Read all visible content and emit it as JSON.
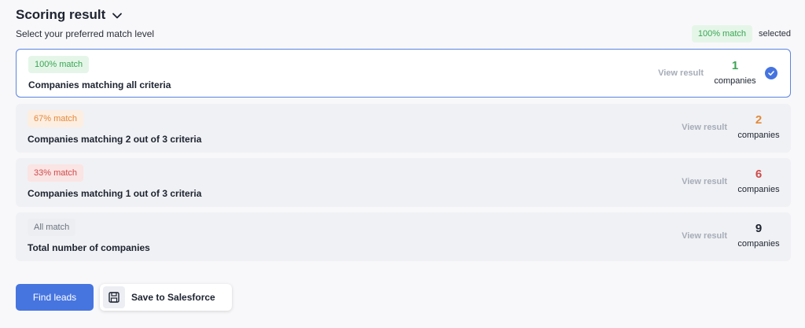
{
  "header": {
    "title": "Scoring result",
    "subtitle": "Select your preferred match level",
    "selected_badge": "100% match",
    "selected_text": "selected"
  },
  "options": [
    {
      "badge": "100% match",
      "label": "Companies matching all criteria",
      "view": "View result",
      "count": "1",
      "unit": "companies",
      "color": "#3aa554"
    },
    {
      "badge": "67% match",
      "label": "Companies matching 2 out of 3 criteria",
      "view": "View result",
      "count": "2",
      "unit": "companies",
      "color": "#e38a3a"
    },
    {
      "badge": "33% match",
      "label": "Companies matching 1 out of 3 criteria",
      "view": "View result",
      "count": "6",
      "unit": "companies",
      "color": "#cf4a4a"
    },
    {
      "badge": "All match",
      "label": "Total number of companies",
      "view": "View result",
      "count": "9",
      "unit": "companies",
      "color": "#1d2330"
    }
  ],
  "actions": {
    "find_leads": "Find leads",
    "save_salesforce": "Save to Salesforce"
  },
  "icons": {
    "chevron": "chevron-down-icon",
    "check": "check-circle-icon",
    "save": "floppy-disk-icon"
  }
}
